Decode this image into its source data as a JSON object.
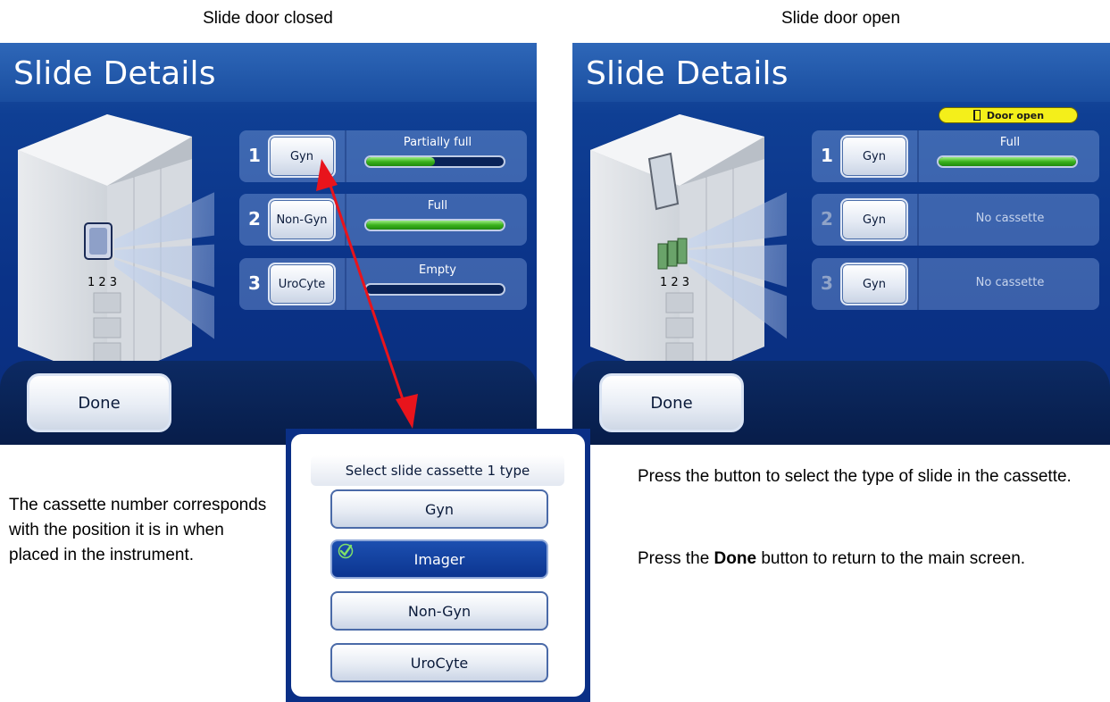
{
  "captions": {
    "left": "Slide door closed",
    "right": "Slide door open"
  },
  "left_screen": {
    "title": "Slide Details",
    "instrument_labels": "1 2 3",
    "rows": [
      {
        "number": "1",
        "type": "Gyn",
        "status": "Partially full",
        "fill_fraction": 0.5
      },
      {
        "number": "2",
        "type": "Non-Gyn",
        "status": "Full",
        "fill_fraction": 1.0
      },
      {
        "number": "3",
        "type": "UroCyte",
        "status": "Empty",
        "fill_fraction": 0.0
      }
    ],
    "done_label": "Done"
  },
  "right_screen": {
    "title": "Slide Details",
    "door_badge": "Door open",
    "instrument_labels": "1 2 3",
    "rows": [
      {
        "number": "1",
        "type": "Gyn",
        "status": "Full",
        "fill_fraction": 1.0
      },
      {
        "number": "2",
        "type": "Gyn",
        "status": "No cassette"
      },
      {
        "number": "3",
        "type": "Gyn",
        "status": "No cassette"
      }
    ],
    "done_label": "Done"
  },
  "popup": {
    "title": "Select slide cassette 1 type",
    "options": [
      "Gyn",
      "Imager",
      "Non-Gyn",
      "UroCyte"
    ],
    "selected": "Imager"
  },
  "notes": {
    "left": "The cassette number corresponds with the position it is in when placed in the instrument.",
    "right_1": "Press the button to select the type of slide in the cassette.",
    "right_2_prefix": "Press the ",
    "right_2_bold": "Done",
    "right_2_suffix": " button to return to the main screen."
  },
  "colors": {
    "screen_blue": "#0f3f94",
    "bar_green": "#3bb21c",
    "badge_yellow": "#f4ef1a",
    "arrow_red": "#e8141c"
  },
  "icons": {
    "door": "door-icon",
    "check": "check-icon"
  }
}
